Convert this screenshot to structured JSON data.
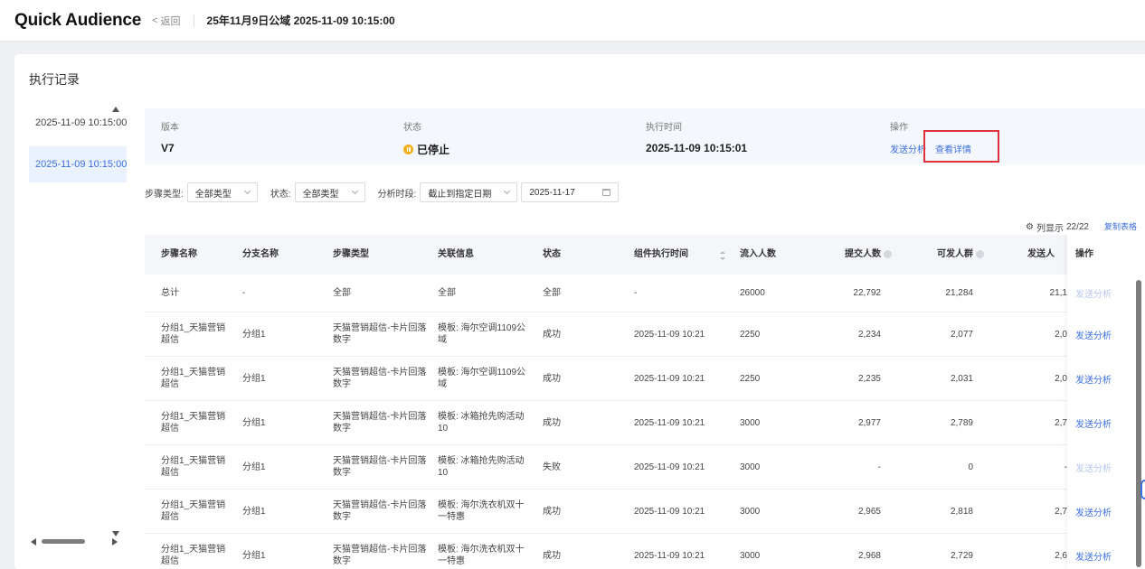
{
  "header": {
    "brand": "Quick Audience",
    "back_label": "返回",
    "title": "25年11月9日公域 2025-11-09 10:15:00"
  },
  "section_title": "执行记录",
  "records": [
    {
      "label": "2025-11-09 10:15:00"
    },
    {
      "label": "2025-11-09 10:15:00"
    }
  ],
  "version_info": {
    "version_label": "版本",
    "version": "V7",
    "status_label": "状态",
    "status": "已停止",
    "exec_time_label": "执行时间",
    "exec_time": "2025-11-09 10:15:01",
    "ops_label": "操作",
    "send_analysis": "发送分析",
    "view_detail": "查看详情"
  },
  "filters": {
    "step_type_label": "步骤类型:",
    "step_type_value": "全部类型",
    "status_label": "状态:",
    "status_value": "全部类型",
    "period_label": "分析时段:",
    "period_value": "截止到指定日期",
    "date_value": "2025-11-17"
  },
  "column_settings": {
    "label": "列显示",
    "count": "22/22",
    "copy_label": "复制表格"
  },
  "table": {
    "headers": [
      "步骤名称",
      "分支名称",
      "步骤类型",
      "关联信息",
      "状态",
      "组件执行时间",
      "流入人数",
      "提交人数",
      "可发人群",
      "发送人",
      "操作"
    ],
    "rows": [
      {
        "name": "总计",
        "branch": "-",
        "type": "全部",
        "info": "全部",
        "status": "全部",
        "time": "-",
        "inflow": "26000",
        "submit": "22,792",
        "sendable": "21,284",
        "sent": "21,1",
        "op": "发送分析"
      },
      {
        "name": "分组1_天猫营销超信",
        "branch": "分组1",
        "type": "天猫营销超信-卡片回落数字",
        "info": "模板: 海尔空调1109公域",
        "status": "成功",
        "time": "2025-11-09 10:21",
        "inflow": "2250",
        "submit": "2,234",
        "sendable": "2,077",
        "sent": "2,0",
        "op": "发送分析"
      },
      {
        "name": "分组1_天猫营销超信",
        "branch": "分组1",
        "type": "天猫营销超信-卡片回落数字",
        "info": "模板: 海尔空调1109公域",
        "status": "成功",
        "time": "2025-11-09 10:21",
        "inflow": "2250",
        "submit": "2,235",
        "sendable": "2,031",
        "sent": "2,0",
        "op": "发送分析"
      },
      {
        "name": "分组1_天猫营销超信",
        "branch": "分组1",
        "type": "天猫营销超信-卡片回落数字",
        "info": "模板: 冰箱抢先购活动10",
        "status": "成功",
        "time": "2025-11-09 10:21",
        "inflow": "3000",
        "submit": "2,977",
        "sendable": "2,789",
        "sent": "2,7",
        "op": "发送分析"
      },
      {
        "name": "分组1_天猫营销超信",
        "branch": "分组1",
        "type": "天猫营销超信-卡片回落数字",
        "info": "模板: 冰箱抢先购活动10",
        "status": "失败",
        "time": "2025-11-09 10:21",
        "inflow": "3000",
        "submit": "-",
        "sendable": "0",
        "sent": "-",
        "op": "发送分析"
      },
      {
        "name": "分组1_天猫营销超信",
        "branch": "分组1",
        "type": "天猫营销超信-卡片回落数字",
        "info": "模板: 海尔洗衣机双十一特惠",
        "status": "成功",
        "time": "2025-11-09 10:21",
        "inflow": "3000",
        "submit": "2,965",
        "sendable": "2,818",
        "sent": "2,7",
        "op": "发送分析"
      },
      {
        "name": "分组1_天猫营销超信",
        "branch": "分组1",
        "type": "天猫营销超信-卡片回落数字",
        "info": "模板: 海尔洗衣机双十一特惠",
        "status": "成功",
        "time": "2025-11-09 10:21",
        "inflow": "3000",
        "submit": "2,968",
        "sendable": "2,729",
        "sent": "2,6",
        "op": "发送分析"
      }
    ]
  },
  "colors": {
    "accent": "#3d6fe0",
    "highlight": "#e0323a",
    "paused": "#f2b01e"
  }
}
